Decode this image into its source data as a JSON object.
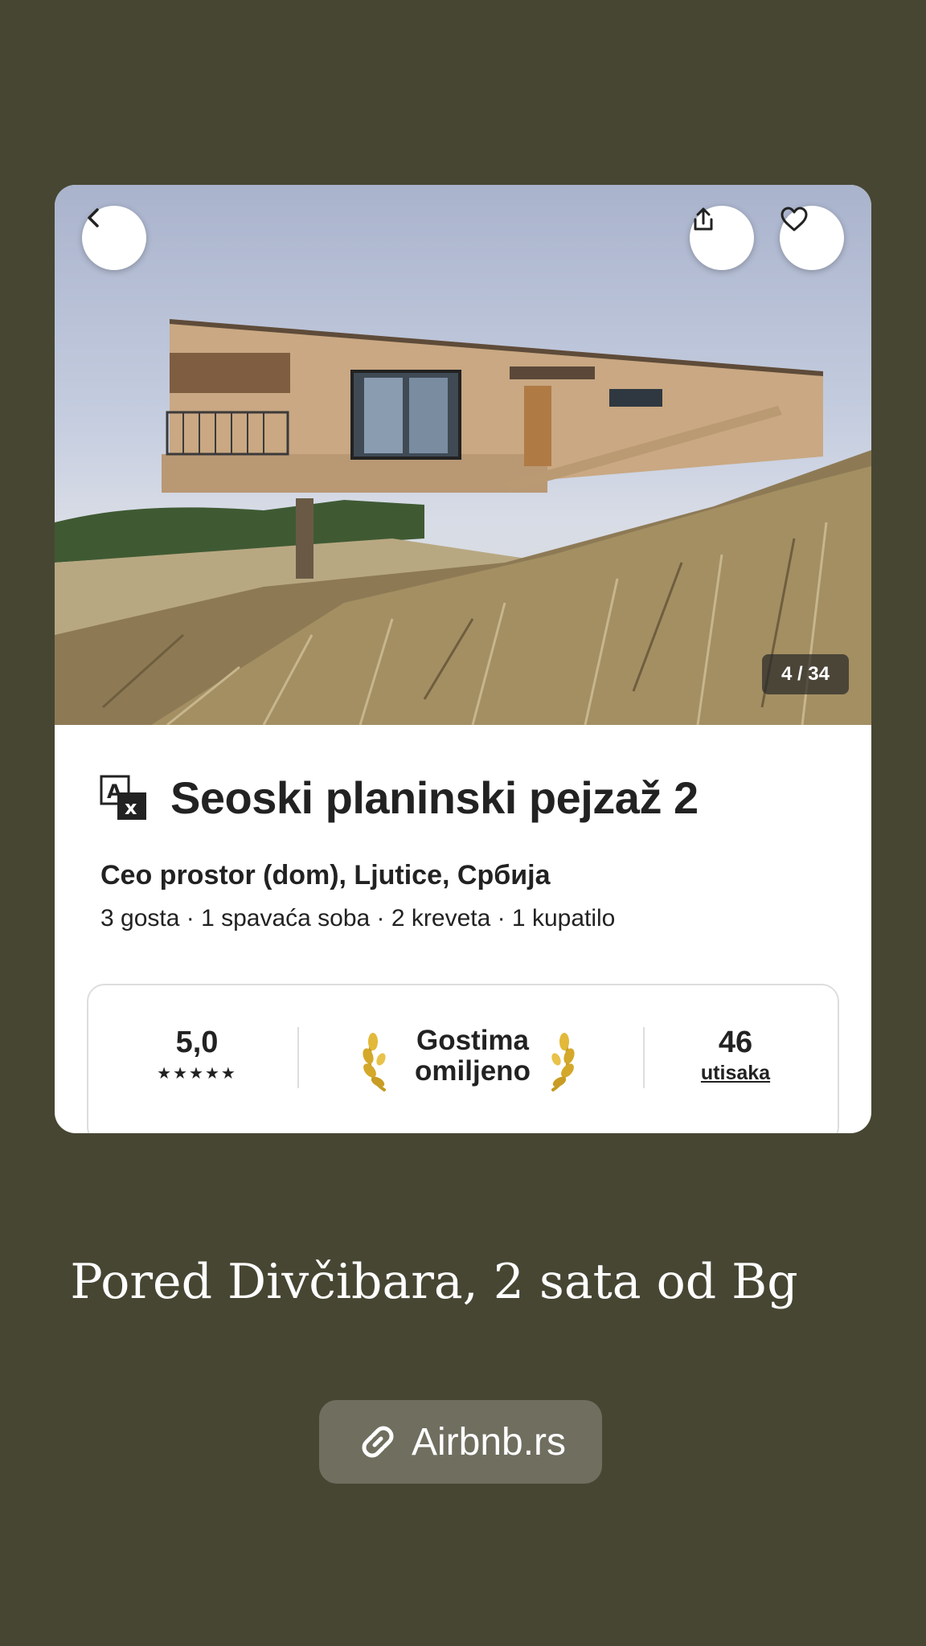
{
  "listing": {
    "photo_counter": "4 / 34",
    "title": "Seoski planinski pejzaž 2",
    "subtitle": "Ceo prostor (dom), Ljutice, Србија",
    "details": "3 gosta · 1 spavaća soba · 2 kreveta · 1 kupatilo",
    "rating": "5,0",
    "stars": "★★★★★",
    "star_count": 5,
    "guest_favorite_line1": "Gostima",
    "guest_favorite_line2": "omiljeno",
    "reviews_count": "46",
    "reviews_label": "utisaka"
  },
  "icons": {
    "back": "chevron-left-icon",
    "share": "share-icon",
    "save": "heart-icon",
    "translate": "translate-icon",
    "laurel": "laurel-icon",
    "link": "link-icon"
  },
  "caption": "Pored Divčibara, 2 sata od Bg",
  "link_sticker": {
    "label": "Airbnb.rs"
  },
  "colors": {
    "background": "#474633",
    "card": "#ffffff",
    "text": "#222222",
    "laurel_gold": "#d4a82a"
  }
}
